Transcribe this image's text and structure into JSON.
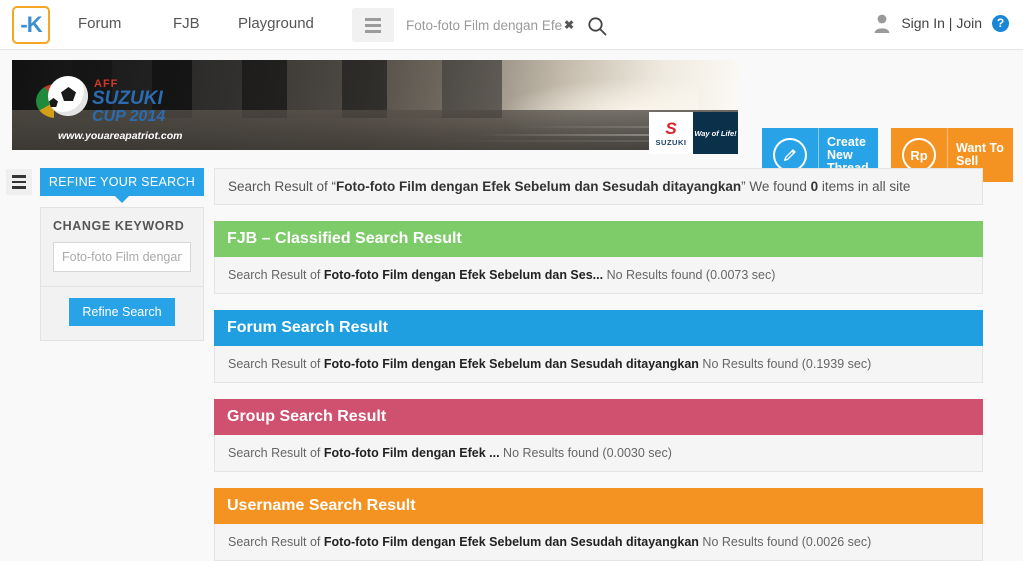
{
  "nav": {
    "logo_text": "-K",
    "links": [
      {
        "label": "Forum"
      },
      {
        "label": "FJB"
      },
      {
        "label": "Playground"
      }
    ],
    "menu_icon": "hamburger-icon",
    "search": {
      "value": "Foto-foto Film dengan Efek Sebelum dan Sesudah ditayangkan",
      "display_value": "Foto-foto Film dengan Efek Sel",
      "placeholder": "Foto-foto Film dengan Efek Sel",
      "clear_label": "✖",
      "search_icon": "search-icon"
    },
    "account": {
      "avatar_icon": "user-avatar-icon",
      "signin_label": "Sign In | Join",
      "help_label": "?"
    }
  },
  "banner": {
    "ad": {
      "aff": "AFF",
      "suzuki": "SUZUKI",
      "cup": "CUP 2014",
      "url": "www.youareapatriot.com"
    },
    "sponsor": {
      "mark": "S",
      "name": "SUZUKI",
      "tagline": "Way of Life!"
    },
    "cta": [
      {
        "icon": "pencil-icon",
        "icon_text": "✎",
        "label": "Create\nNew\nThread",
        "line1": "Create",
        "line2": "New",
        "line3": "Thread",
        "color": "#29a3e8"
      },
      {
        "icon": "rupiah-icon",
        "icon_text": "Rp",
        "label": "Want To\nSell",
        "line1": "Want To",
        "line2": "Sell",
        "line3": "",
        "color": "#f59322"
      }
    ]
  },
  "sidebar": {
    "toggle_icon": "sidebar-toggle-icon",
    "refine_header": "REFINE YOUR SEARCH",
    "change_keyword_label": "CHANGE KEYWORD",
    "keyword_input_placeholder": "Foto-foto Film dengan Efek Sebelum dan Sesudah ditayangkan",
    "keyword_input_value": "",
    "refine_button": "Refine Search"
  },
  "main": {
    "summary": {
      "prefix": "Search Result of “",
      "query": "Foto-foto Film dengan Efek Sebelum dan Sesudah ditayangkan",
      "middle": "” We found ",
      "count": "0",
      "suffix": " items in all site"
    },
    "sections": [
      {
        "title": "FJB – Classified Search Result",
        "color": "#7ecb6a",
        "line_prefix": "Search Result of ",
        "line_query": "Foto-foto Film dengan Efek Sebelum dan Ses...",
        "line_suffix": " No Results found (0.0073 sec)"
      },
      {
        "title": "Forum Search Result",
        "color": "#1f9fe0",
        "line_prefix": "Search Result of ",
        "line_query": "Foto-foto Film dengan Efek Sebelum dan Sesudah ditayangkan",
        "line_suffix": " No Results found (0.1939 sec)"
      },
      {
        "title": "Group Search Result",
        "color": "#d0506f",
        "line_prefix": "Search Result of ",
        "line_query": "Foto-foto Film dengan Efek ...",
        "line_suffix": " No Results found (0.0030 sec)"
      },
      {
        "title": "Username Search Result",
        "color": "#f59322",
        "line_prefix": "Search Result of ",
        "line_query": "Foto-foto Film dengan Efek Sebelum dan Sesudah ditayangkan",
        "line_suffix": " No Results found (0.0026 sec)"
      }
    ]
  },
  "colors": {
    "accent_blue": "#29a3e8",
    "orange": "#f59322",
    "green": "#7ecb6a",
    "pink": "#d0506f",
    "page_bg": "#f9f9f9"
  }
}
